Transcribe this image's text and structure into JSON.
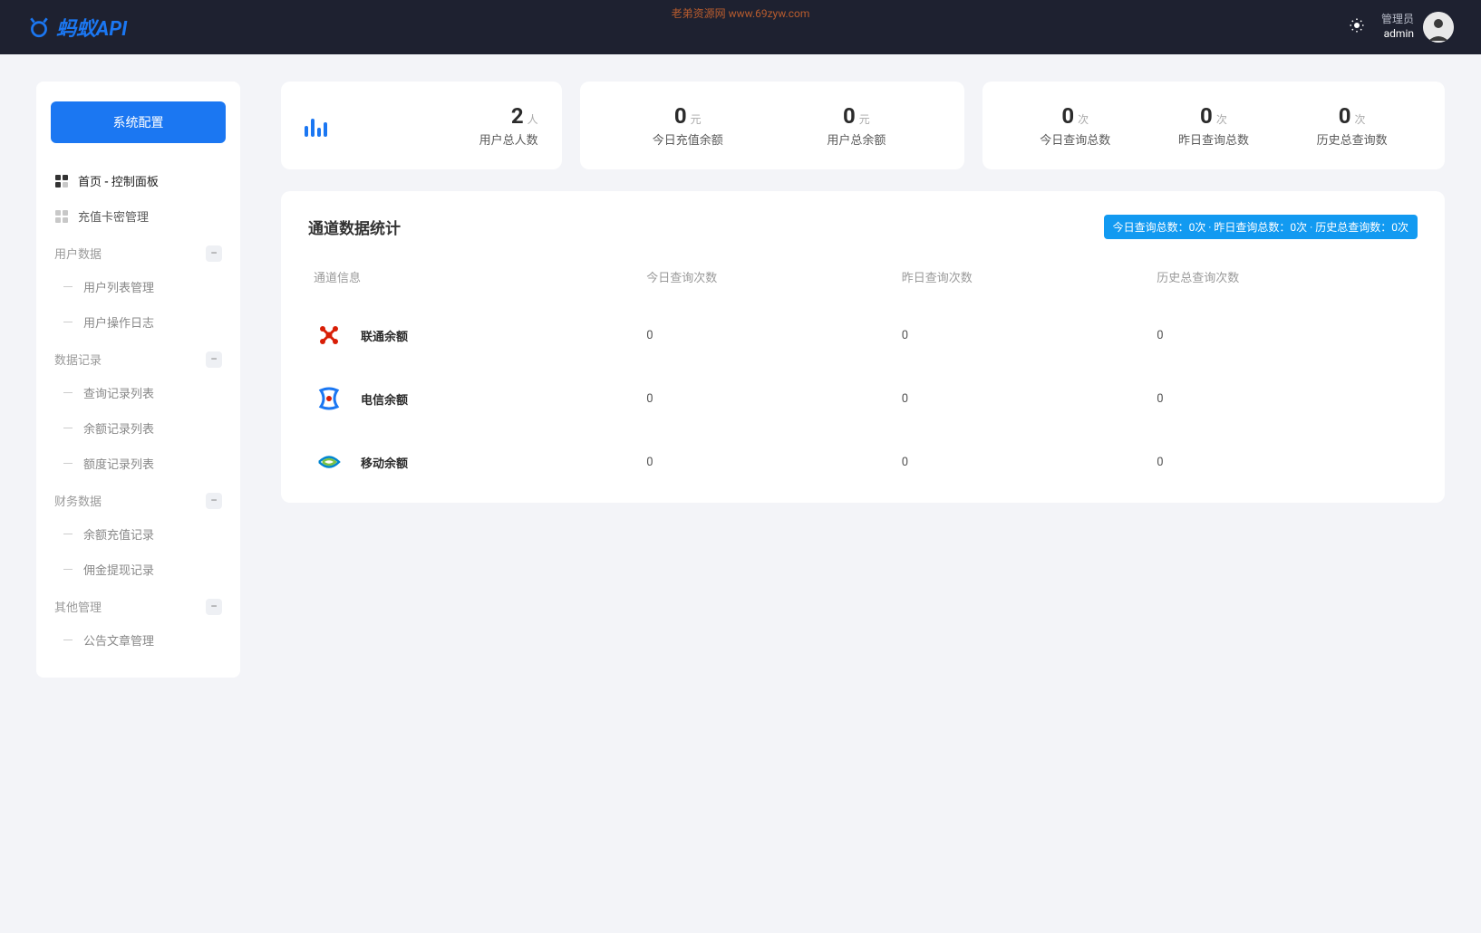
{
  "watermark": "老弟资源网 www.69zyw.com",
  "logo_text": "蚂蚁API",
  "user": {
    "role": "管理员",
    "name": "admin"
  },
  "sidebar": {
    "config_btn": "系统配置",
    "items": [
      {
        "label": "首页 - 控制面板",
        "active": true
      },
      {
        "label": "充值卡密管理",
        "active": false
      }
    ],
    "sections": [
      {
        "title": "用户数据",
        "subs": [
          "用户列表管理",
          "用户操作日志"
        ]
      },
      {
        "title": "数据记录",
        "subs": [
          "查询记录列表",
          "余额记录列表",
          "额度记录列表"
        ]
      },
      {
        "title": "财务数据",
        "subs": [
          "余额充值记录",
          "佣金提现记录"
        ]
      },
      {
        "title": "其他管理",
        "subs": [
          "公告文章管理"
        ]
      }
    ]
  },
  "stats": {
    "card1": {
      "value": "2",
      "unit": "人",
      "label": "用户总人数"
    },
    "card2": [
      {
        "value": "0",
        "unit": "元",
        "label": "今日充值余额"
      },
      {
        "value": "0",
        "unit": "元",
        "label": "用户总余额"
      }
    ],
    "card3": [
      {
        "value": "0",
        "unit": "次",
        "label": "今日查询总数"
      },
      {
        "value": "0",
        "unit": "次",
        "label": "昨日查询总数"
      },
      {
        "value": "0",
        "unit": "次",
        "label": "历史总查询数"
      }
    ]
  },
  "table": {
    "title": "通道数据统计",
    "badge": "今日查询总数：0次 · 昨日查询总数：0次 · 历史总查询数：0次",
    "headers": [
      "通道信息",
      "今日查询次数",
      "昨日查询次数",
      "历史总查询次数"
    ],
    "rows": [
      {
        "name": "联通余额",
        "today": "0",
        "yesterday": "0",
        "history": "0"
      },
      {
        "name": "电信余额",
        "today": "0",
        "yesterday": "0",
        "history": "0"
      },
      {
        "name": "移动余额",
        "today": "0",
        "yesterday": "0",
        "history": "0"
      }
    ]
  }
}
